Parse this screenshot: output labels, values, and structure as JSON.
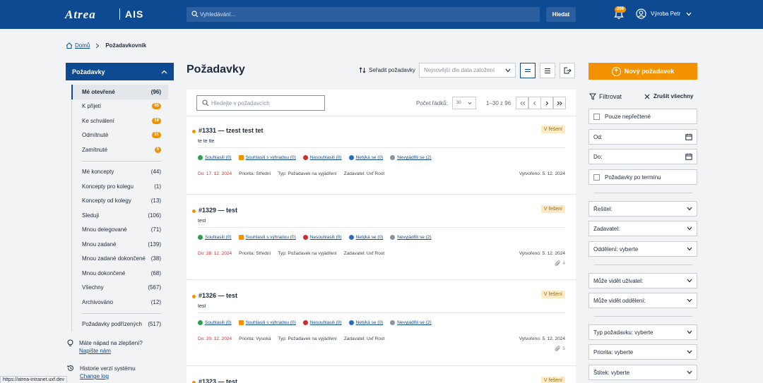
{
  "header": {
    "logo_text": "Atrea",
    "app_name": "AIS",
    "search_placeholder": "Vyhledávání...",
    "search_button": "Hledat",
    "notifications_count": "268",
    "user_name": "Výroba Petr"
  },
  "breadcrumb": {
    "home": "Domů",
    "current": "Požadavkovník"
  },
  "sidebar": {
    "title": "Požadavky",
    "group1": [
      {
        "label": "Mé otevřené",
        "count": "(96)",
        "badge": false,
        "active": true
      },
      {
        "label": "K přijetí",
        "count": "85",
        "badge": true
      },
      {
        "label": "Ke schválení",
        "count": "19",
        "badge": true
      },
      {
        "label": "Odmítnuté",
        "count": "31",
        "badge": true
      },
      {
        "label": "Zamítnuté",
        "count": "5",
        "badge": true
      }
    ],
    "group2": [
      {
        "label": "Mé koncepty",
        "count": "(44)"
      },
      {
        "label": "Koncepty pro kolegu",
        "count": "(1)"
      },
      {
        "label": "Koncepty od kolegy",
        "count": "(13)"
      },
      {
        "label": "Sleduji",
        "count": "(106)"
      },
      {
        "label": "Mnou delegované",
        "count": "(71)"
      },
      {
        "label": "Mnou zadané",
        "count": "(139)"
      },
      {
        "label": "Mnou zadané dokončené",
        "count": "(38)"
      },
      {
        "label": "Mnou dokončené",
        "count": "(68)"
      },
      {
        "label": "Všechny",
        "count": "(567)"
      },
      {
        "label": "Archivováno",
        "count": "(12)"
      }
    ],
    "group3": [
      {
        "label": "Požadavky podřízených",
        "count": "(517)"
      }
    ],
    "idea": {
      "text": "Máte nápad na zlepšení?",
      "link": "Napište nám"
    },
    "history": {
      "text": "Historie verzí systému",
      "link": "Change log"
    }
  },
  "main": {
    "title": "Požadavky",
    "sort_label": "Seřadit požadavky",
    "sort_value": "Nejnovější dle data založení",
    "search_placeholder": "Hledejte v požadavcích",
    "rows_label": "Počet řádků:",
    "rows_value": "30",
    "range": "1–30 z 96",
    "vote_labels": [
      "Souhlasili",
      "Souhlasili s výhradou",
      "Nesouhlasili",
      "Netýká se",
      "Nevyjádřili se"
    ],
    "requests": [
      {
        "title": "#1331 — tzest test tet",
        "state": "V řešení",
        "desc": "te te tte",
        "votes": [
          "Souhlasili (0)",
          "Souhlasili s výhradou (0)",
          "Nesouhlasili (0)",
          "Netýká se (0)",
          "Nevyjádřili se (2)"
        ],
        "due": "Do: 17. 12. 2024",
        "priority": "Priorita: Střední",
        "type": "Typ: Požadavek na vyjádření",
        "author": "Zadavatel: Uxf Root",
        "created": "Vytvořeno: 5. 12. 2024",
        "attachments": ""
      },
      {
        "title": "#1329 — test",
        "state": "V řešení",
        "desc": "test",
        "votes": [
          "Souhlasili (0)",
          "Souhlasili s výhradou (0)",
          "Nesouhlasili (0)",
          "Netýká se (0)",
          "Nevyjádřili se (2)"
        ],
        "due": "Do: 28. 12. 2024",
        "priority": "Priorita: Střední",
        "type": "Typ: Požadavek na vyjádření",
        "author": "Zadavatel: Uxf Root",
        "created": "Vytvořeno: 5. 12. 2024",
        "attachments": "4"
      },
      {
        "title": "#1326 — test",
        "state": "V řešení",
        "desc": "test",
        "votes": [
          "Souhlasili (0)",
          "Souhlasili s výhradou (0)",
          "Nesouhlasili (0)",
          "Netýká se (0)",
          "Nevyjádřili se (2)"
        ],
        "due": "Do: 20. 12. 2024",
        "priority": "Priorita: Vysoká",
        "type": "Typ: Požadavek na vyjádření",
        "author": "Zadavatel: Uxf Root",
        "created": "Vytvořeno: 5. 12. 2024",
        "attachments": "5"
      },
      {
        "title": "#1323 — test",
        "state": "V řešení"
      }
    ]
  },
  "filters": {
    "new_button": "Nový požadavek",
    "title": "Filtrovat",
    "clear": "Zrušit všechny",
    "unread_only": "Pouze nepřečtené",
    "from": "Od:",
    "to": "Do:",
    "overdue": "Požadavky po termínu",
    "solver": "Řešitel:",
    "requester": "Zadavatel:",
    "department": "Oddělení: vyberte",
    "visible_user": "Může vidět uživatel:",
    "visible_department": "Může vidět oddělení:",
    "request_type": "Typ požadavku: vyberte",
    "priority": "Priorita: vyberte",
    "tag": "Štítek: vyberte"
  },
  "status_url": "https://atrea-intranet.uxf.dev",
  "colors": {
    "brand": "#0d4a91",
    "accent": "#f39200",
    "due": "#d22b2b"
  }
}
